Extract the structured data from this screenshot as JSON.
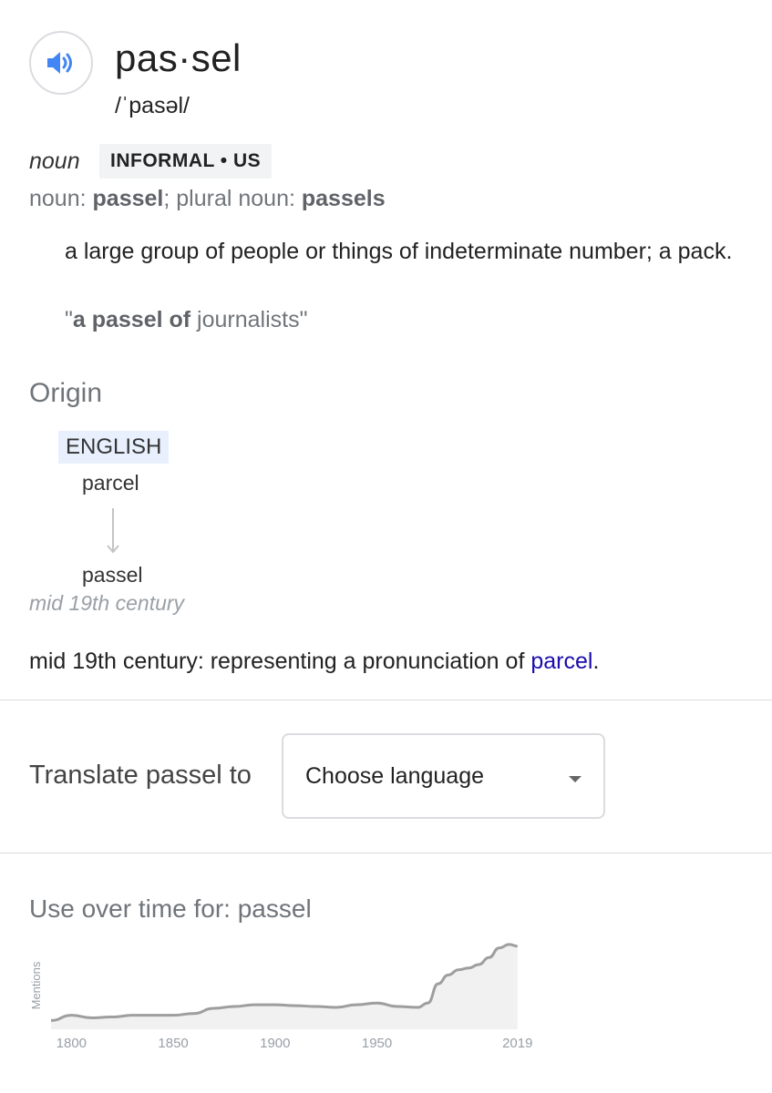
{
  "entry": {
    "word": "pas·sel",
    "phonetic": "/ˈpasəl/",
    "audio_icon": "speaker-icon"
  },
  "sense": {
    "pos": "noun",
    "register": "INFORMAL • US",
    "forms": {
      "noun_label": "noun: ",
      "noun_value": "passel",
      "sep": "; ",
      "plural_label": "plural noun: ",
      "plural_value": "passels"
    },
    "definition": "a large group of people or things of indeterminate number; a pack.",
    "example": {
      "open_quote": "\"",
      "bold": "a passel of",
      "rest": " journalists",
      "close_quote": "\""
    }
  },
  "origin": {
    "title": "Origin",
    "language": "ENGLISH",
    "from_word": "parcel",
    "to_word": "passel",
    "date": "mid 19th century",
    "text_prefix": "mid 19th century: representing a pronunciation of ",
    "link_text": "parcel",
    "text_suffix": "."
  },
  "translate": {
    "label": "Translate passel to",
    "select_value": "Choose language"
  },
  "usage": {
    "title": "Use over time for: passel"
  },
  "chart_data": {
    "type": "area",
    "title": "",
    "xlabel": "",
    "ylabel": "Mentions",
    "x_ticks": [
      "1800",
      "1850",
      "1900",
      "1950",
      "2019"
    ],
    "xlim": [
      1790,
      2020
    ],
    "ylim": [
      0,
      1
    ],
    "fill_color": "#f1f1f1",
    "line_color": "#9e9e9e",
    "series": [
      {
        "x": [
          1790,
          1800,
          1810,
          1820,
          1830,
          1840,
          1850,
          1860,
          1870,
          1880,
          1890,
          1900,
          1910,
          1920,
          1930,
          1940,
          1950,
          1960,
          1970,
          1975,
          1980,
          1985,
          1990,
          1995,
          2000,
          2005,
          2010,
          2015,
          2019
        ],
        "values": [
          0.1,
          0.16,
          0.13,
          0.14,
          0.16,
          0.16,
          0.16,
          0.18,
          0.24,
          0.26,
          0.28,
          0.28,
          0.27,
          0.26,
          0.25,
          0.28,
          0.3,
          0.26,
          0.25,
          0.3,
          0.52,
          0.62,
          0.68,
          0.7,
          0.74,
          0.82,
          0.93,
          0.97,
          0.95
        ]
      }
    ]
  }
}
